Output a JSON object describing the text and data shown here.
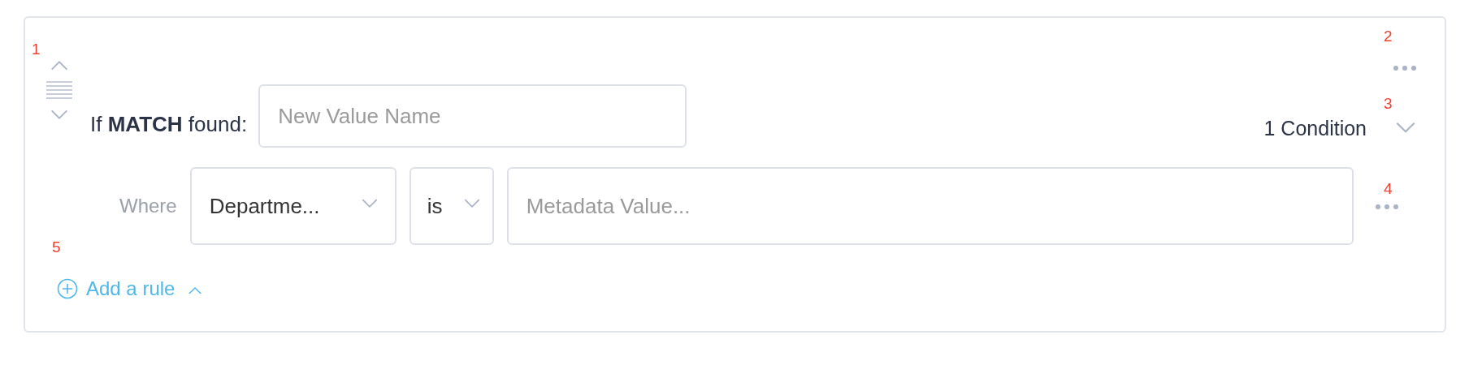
{
  "rule": {
    "markers": [
      "1",
      "2",
      "3",
      "4",
      "5"
    ],
    "heading": "If **MATCH** found:",
    "value_name": {
      "placeholder": "New Value Name"
    },
    "conditions_summary": "1 Condition",
    "expanded": false,
    "conditions": [
      {
        "prefix": "Where",
        "field": "Departme...",
        "operator": "is",
        "value": {
          "placeholder": "Metadata Value..."
        }
      }
    ],
    "add_rule": {
      "label": "Add a rule",
      "expanded": true
    }
  }
}
